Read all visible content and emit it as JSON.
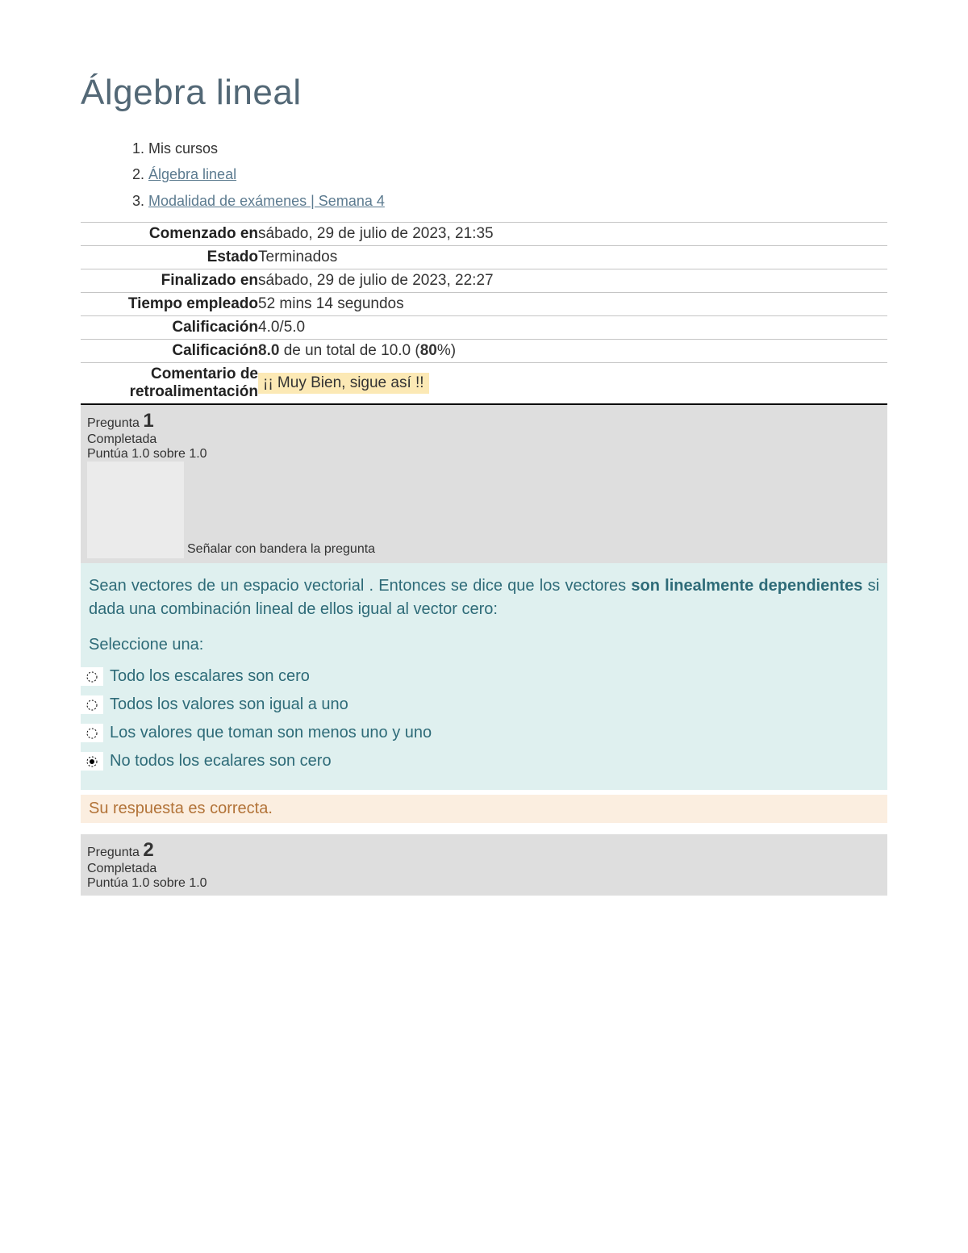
{
  "title": "Álgebra lineal",
  "breadcrumb": {
    "items": [
      {
        "label": "Mis cursos",
        "link": false
      },
      {
        "label": "Álgebra lineal",
        "link": true
      },
      {
        "label": "Modalidad de exámenes | Semana 4",
        "link": true
      }
    ]
  },
  "summary": {
    "started_label": "Comenzado en",
    "started_value": "sábado, 29 de julio de 2023, 21:35",
    "state_label": "Estado",
    "state_value": "Terminados",
    "finished_label": "Finalizado en",
    "finished_value": "sábado, 29 de julio de 2023, 22:27",
    "time_label": "Tiempo empleado",
    "time_value": "52 mins 14 segundos",
    "grade1_label": "Calificación",
    "grade1_value": "4.0/5.0",
    "grade2_label": "Calificación",
    "grade2_bold": "8.0",
    "grade2_mid": " de un total de 10.0 (",
    "grade2_pct": "80",
    "grade2_tail": "%)",
    "feedback_label": "Comentario de retroalimentación",
    "feedback_value": "¡¡ Muy Bien, sigue así !!"
  },
  "q1": {
    "word_question": "Pregunta ",
    "number": "1",
    "completed": "Completada",
    "score": "Puntúa 1.0 sobre 1.0",
    "flag": "Señalar con bandera la pregunta",
    "stem_a": "Sean vectores de un espacio vectorial . Entonces se dice que los vectores ",
    "stem_bold": "son linealmente dependientes",
    "stem_b": " si dada una combinación lineal de ellos igual al vector cero:",
    "prompt": "Seleccione una:",
    "options": [
      {
        "text": "Todo los escalares son cero",
        "selected": false
      },
      {
        "text": "Todos los valores son igual a uno",
        "selected": false
      },
      {
        "text": "Los valores que toman son menos uno y uno",
        "selected": false
      },
      {
        "text": "No todos los ecalares son cero",
        "selected": true
      }
    ],
    "feedback": "Su respuesta es correcta."
  },
  "q2": {
    "word_question": "Pregunta ",
    "number": "2",
    "completed": "Completada",
    "score": "Puntúa 1.0 sobre 1.0"
  }
}
